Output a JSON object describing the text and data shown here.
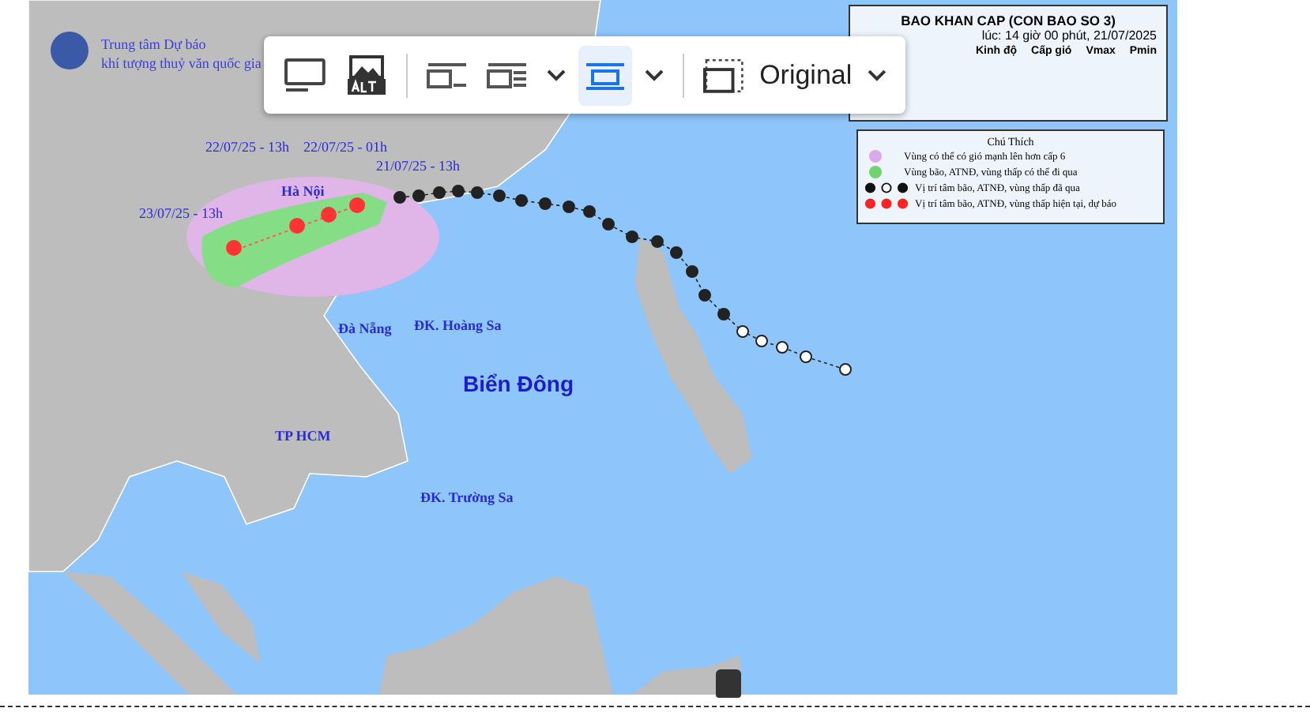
{
  "map": {
    "agency": [
      "Trung tâm Dự báo",
      "khí tượng thuỷ văn quốc gia"
    ],
    "labels": [
      {
        "kind": "time",
        "text": "22/07/25 - 13h"
      },
      {
        "kind": "time",
        "text": "22/07/25 - 01h"
      },
      {
        "kind": "time",
        "text": "21/07/25 - 13h"
      },
      {
        "kind": "time",
        "text": "23/07/25 - 13h"
      },
      {
        "kind": "city",
        "text": "Hà Nội"
      },
      {
        "kind": "city",
        "text": "Đà Nẵng"
      },
      {
        "kind": "city",
        "text": "ĐK. Hoàng Sa"
      },
      {
        "kind": "sea",
        "text": "Biển Đông"
      },
      {
        "kind": "city",
        "text": "TP HCM"
      },
      {
        "kind": "city",
        "text": "ĐK. Trường Sa"
      }
    ],
    "bulletin": {
      "title": "BAO KHAN CAP (CON BAO SO 3)",
      "issued": "lúc: 14 giờ 00 phút, 21/07/2025",
      "columns": [
        "Kinh độ",
        "Cấp gió",
        "Vmax",
        "Pmin"
      ]
    },
    "legend": {
      "title": "Chú Thích",
      "items": [
        {
          "kind": "pink",
          "text": "Vùng có thể có gió mạnh lên hơn cấp 6"
        },
        {
          "kind": "green",
          "text": "Vùng bão, ATNĐ, vùng thấp có thể đi qua"
        },
        {
          "kind": "past",
          "text": "Vị trí tâm bão, ATNĐ, vùng thấp đã qua"
        },
        {
          "kind": "forecast",
          "text": "Vị trí tâm bão, ATNĐ, vùng thấp hiện tại, dự báo"
        }
      ]
    }
  },
  "toolbar": {
    "wrap_options": [
      {
        "kind": "inline",
        "selected": false
      },
      {
        "kind": "wrap",
        "selected": false
      },
      {
        "kind": "break",
        "selected": true
      }
    ],
    "size": "Original"
  }
}
